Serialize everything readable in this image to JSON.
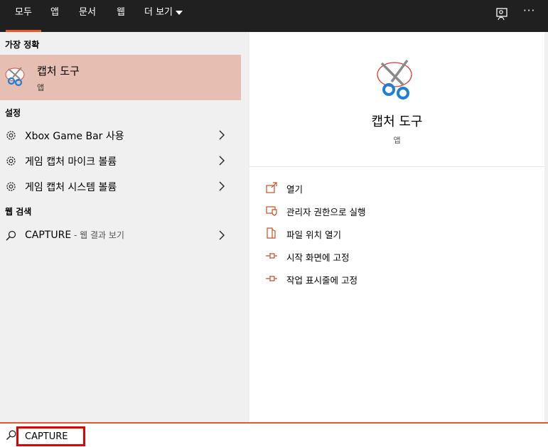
{
  "tabs": [
    {
      "label": "모두",
      "active": true
    },
    {
      "label": "앱"
    },
    {
      "label": "문서"
    },
    {
      "label": "웹"
    },
    {
      "label": "더 보기"
    }
  ],
  "left": {
    "best_match_title": "가장 정확",
    "best": {
      "title": "캡처 도구",
      "subtitle": "앱",
      "icon": "snipping-tool-icon"
    },
    "settings_title": "설정",
    "settings": [
      {
        "label": "Xbox Game Bar 사용",
        "icon": "gear-icon"
      },
      {
        "label": "게임 캡처 마이크 볼륨",
        "icon": "gear-icon"
      },
      {
        "label": "게임 캡처 시스템 볼륨",
        "icon": "gear-icon"
      }
    ],
    "web_title": "웹 검색",
    "web": {
      "query": "CAPTURE",
      "suffix": " - 웹 결과 보기",
      "icon": "search-icon"
    }
  },
  "right": {
    "title": "캡처 도구",
    "subtitle": "앱",
    "actions": [
      {
        "label": "열기",
        "icon": "open-icon"
      },
      {
        "label": "관리자 권한으로 실행",
        "icon": "admin-shield-icon"
      },
      {
        "label": "파일 위치 열기",
        "icon": "file-location-icon"
      },
      {
        "label": "시작 화면에 고정",
        "icon": "pin-icon"
      },
      {
        "label": "작업 표시줄에 고정",
        "icon": "pin-icon"
      }
    ]
  },
  "search": {
    "value": "CAPTURE"
  },
  "colors": {
    "accent": "#e8582a",
    "selected": "#e7bfb2",
    "topbar": "#202020",
    "highlight_box": "#e00000"
  }
}
